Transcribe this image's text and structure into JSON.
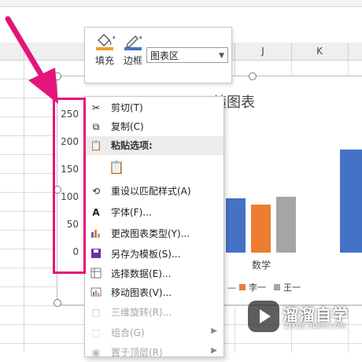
{
  "sheet": {
    "columns": [
      "J",
      "K"
    ]
  },
  "chart": {
    "title_fragment": "绩图表",
    "x_label": "数学",
    "y_ticks": [
      "250",
      "200",
      "150",
      "100",
      "50",
      "0"
    ],
    "legend": [
      {
        "label": "李一",
        "color": "#ed7d31"
      },
      {
        "label": "王一",
        "color": "#a5a5a5"
      }
    ],
    "series_colors": {
      "blue": "#4472c4",
      "orange": "#ed7d31",
      "gray": "#a5a5a5"
    }
  },
  "mini_toolbar": {
    "fill_label": "填充",
    "border_label": "边框",
    "combo_value": "图表区"
  },
  "context_menu": {
    "items": [
      {
        "label": "剪切(T)",
        "icon": "scissors-icon"
      },
      {
        "label": "复制(C)",
        "icon": "copy-icon"
      },
      {
        "label": "粘贴选项:",
        "icon": "paste-icon"
      },
      {
        "label": "",
        "icon": "paste-option-icon"
      },
      {
        "label": "重设以匹配样式(A)",
        "icon": "reset-style-icon"
      },
      {
        "label": "字体(F)...",
        "icon": "font-icon"
      },
      {
        "label": "更改图表类型(Y)...",
        "icon": "chart-type-icon"
      },
      {
        "label": "另存为模板(S)...",
        "icon": "save-template-icon"
      },
      {
        "label": "选择数据(E)...",
        "icon": "select-data-icon"
      },
      {
        "label": "移动图表(V)...",
        "icon": "move-chart-icon"
      },
      {
        "label": "三维旋转(R)...",
        "icon": "rotate-3d-icon"
      },
      {
        "label": "组合(G)",
        "icon": "group-icon"
      },
      {
        "label": "置于顶层(R)",
        "icon": "bring-front-icon"
      }
    ]
  },
  "watermark": {
    "title": "溜溜自学",
    "url": "ZIXUE.3D66.COM"
  },
  "highlight_color": "#e4147a"
}
